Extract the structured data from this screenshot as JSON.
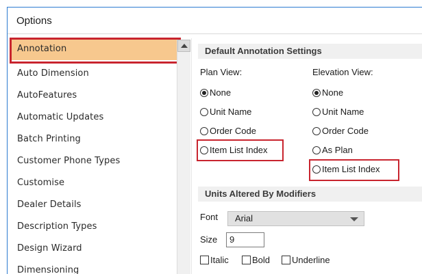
{
  "window": {
    "title": "Options"
  },
  "sidebar": {
    "items": [
      {
        "label": "Annotation",
        "selected": true
      },
      {
        "label": "Auto Dimension"
      },
      {
        "label": "AutoFeatures"
      },
      {
        "label": "Automatic Updates"
      },
      {
        "label": "Batch Printing"
      },
      {
        "label": "Customer Phone Types"
      },
      {
        "label": "Customise"
      },
      {
        "label": "Dealer Details"
      },
      {
        "label": "Description Types"
      },
      {
        "label": "Design Wizard"
      },
      {
        "label": "Dimensioning"
      }
    ]
  },
  "annotation": {
    "header": "Default Annotation Settings",
    "plan_view": {
      "label": "Plan View:",
      "options": [
        "None",
        "Unit Name",
        "Order Code",
        "Item List Index"
      ],
      "selected": "None"
    },
    "elevation_view": {
      "label": "Elevation View:",
      "options": [
        "None",
        "Unit Name",
        "Order Code",
        "As Plan",
        "Item List Index"
      ],
      "selected": "None"
    }
  },
  "units_altered": {
    "header": "Units Altered By Modifiers",
    "font_label": "Font",
    "font_value": "Arial",
    "size_label": "Size",
    "size_value": "9",
    "italic_label": "Italic",
    "bold_label": "Bold",
    "underline_label": "Underline"
  },
  "colors": {
    "highlight": "#c8242e",
    "selection": "#f7c88e",
    "accent": "#2b7bd0"
  }
}
